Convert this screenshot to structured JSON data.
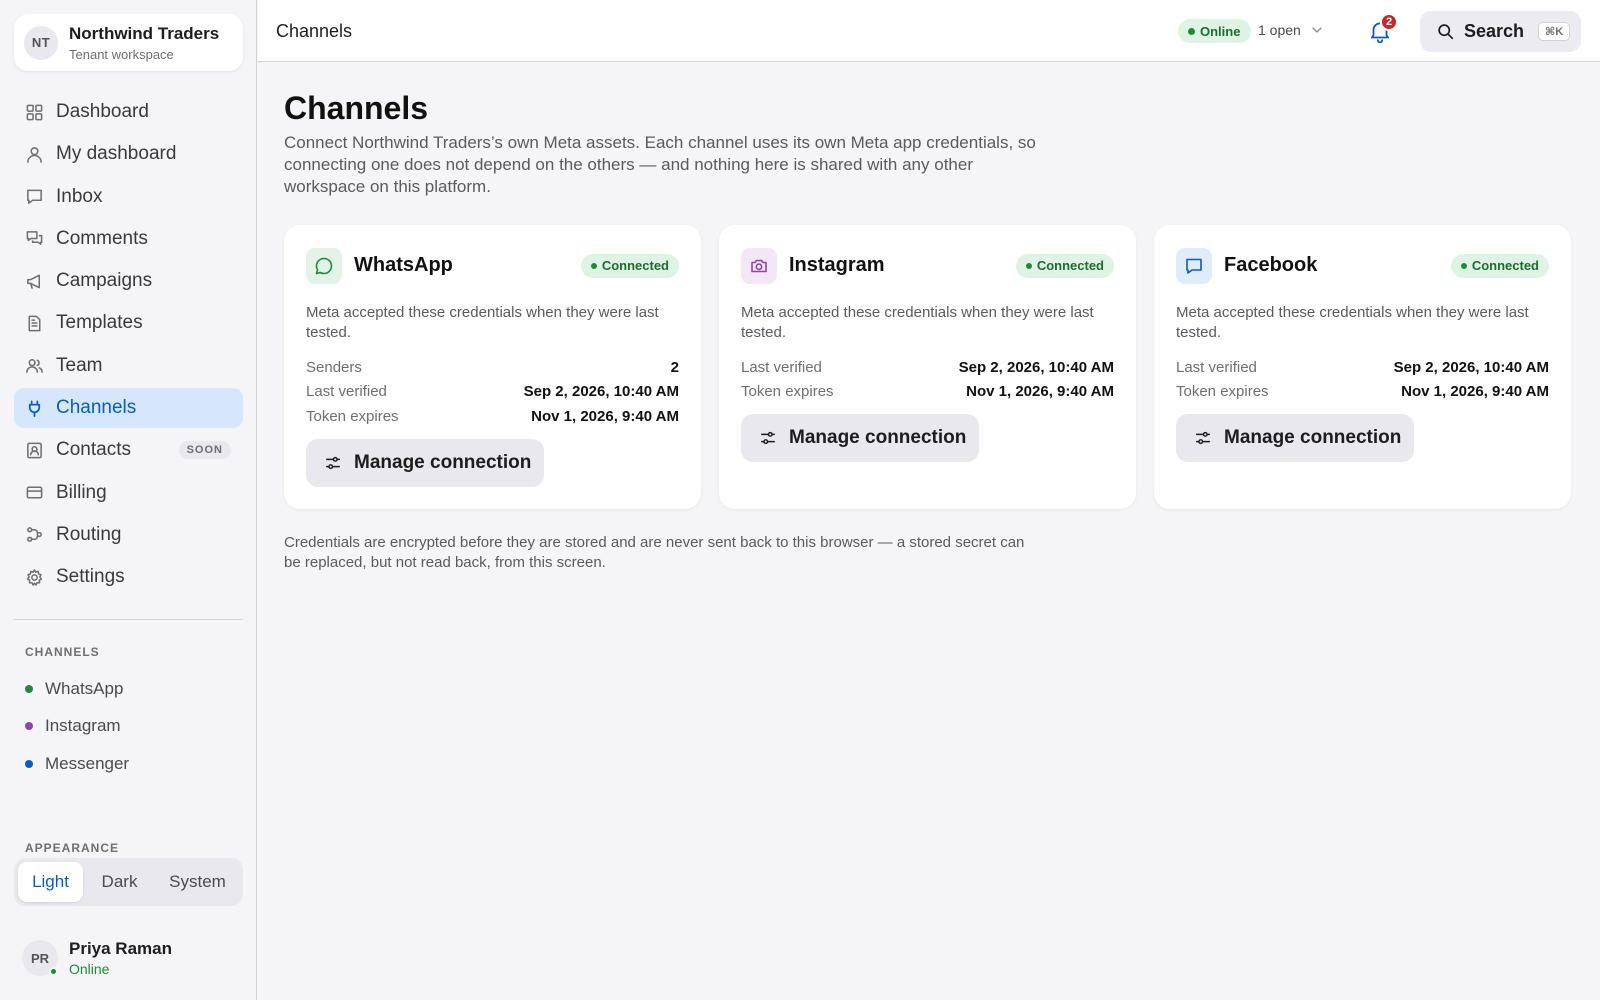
{
  "workspace": {
    "initials": "NT",
    "name": "Northwind Traders",
    "subtitle": "Tenant workspace"
  },
  "nav": {
    "items": [
      {
        "label": "Dashboard",
        "icon": "grid-icon"
      },
      {
        "label": "My dashboard",
        "icon": "user-icon"
      },
      {
        "label": "Inbox",
        "icon": "message-icon"
      },
      {
        "label": "Comments",
        "icon": "comments-icon"
      },
      {
        "label": "Campaigns",
        "icon": "megaphone-icon"
      },
      {
        "label": "Templates",
        "icon": "document-icon"
      },
      {
        "label": "Team",
        "icon": "team-icon"
      },
      {
        "label": "Channels",
        "icon": "plug-icon",
        "active": true
      },
      {
        "label": "Contacts",
        "icon": "contacts-icon",
        "badge": "SOON"
      },
      {
        "label": "Billing",
        "icon": "card-icon"
      },
      {
        "label": "Routing",
        "icon": "routing-icon"
      },
      {
        "label": "Settings",
        "icon": "gear-icon"
      }
    ]
  },
  "sidebar_channels": {
    "heading": "CHANNELS",
    "items": [
      {
        "label": "WhatsApp",
        "color": "#1f8a3a"
      },
      {
        "label": "Instagram",
        "color": "#8e44ad"
      },
      {
        "label": "Messenger",
        "color": "#0a5cc2"
      }
    ]
  },
  "appearance": {
    "heading": "APPEARANCE",
    "options": [
      "Light",
      "Dark",
      "System"
    ],
    "selected": "Light"
  },
  "user": {
    "initials": "PR",
    "name": "Priya Raman",
    "status": "Online"
  },
  "topbar": {
    "title": "Channels",
    "status": "Online",
    "open_count": "1 open",
    "notifications": "2",
    "search_label": "Search",
    "search_shortcut": "⌘K"
  },
  "page": {
    "title": "Channels",
    "description": "Connect Northwind Traders’s own Meta assets. Each channel uses its own Meta app credentials, so connecting one does not depend on the others — and nothing here is shared with any other workspace on this platform.",
    "footnote": "Credentials are encrypted before they are stored and are never sent back to this browser — a stored secret can be replaced, but not read back, from this screen."
  },
  "cards": [
    {
      "name": "WhatsApp",
      "icon": "whatsapp-icon",
      "icon_bg": "#e3f3e7",
      "icon_color": "#1f8a3a",
      "status": "Connected",
      "description": "Meta accepted these credentials when they were last tested.",
      "facts": [
        {
          "key": "Senders",
          "value": "2"
        },
        {
          "key": "Last verified",
          "value": "Sep 2, 2026, 10:40 AM"
        },
        {
          "key": "Token expires",
          "value": "Nov 1, 2026, 9:40 AM"
        }
      ],
      "button": "Manage connection"
    },
    {
      "name": "Instagram",
      "icon": "camera-icon",
      "icon_bg": "#f3e6f5",
      "icon_color": "#8e44ad",
      "status": "Connected",
      "description": "Meta accepted these credentials when they were last tested.",
      "facts": [
        {
          "key": "Last verified",
          "value": "Sep 2, 2026, 10:40 AM"
        },
        {
          "key": "Token expires",
          "value": "Nov 1, 2026, 9:40 AM"
        }
      ],
      "button": "Manage connection"
    },
    {
      "name": "Facebook",
      "icon": "chat-bubble-icon",
      "icon_bg": "#e1ecfb",
      "icon_color": "#0a5cc2",
      "status": "Connected",
      "description": "Meta accepted these credentials when they were last tested.",
      "facts": [
        {
          "key": "Last verified",
          "value": "Sep 2, 2026, 10:40 AM"
        },
        {
          "key": "Token expires",
          "value": "Nov 1, 2026, 9:40 AM"
        }
      ],
      "button": "Manage connection"
    }
  ]
}
